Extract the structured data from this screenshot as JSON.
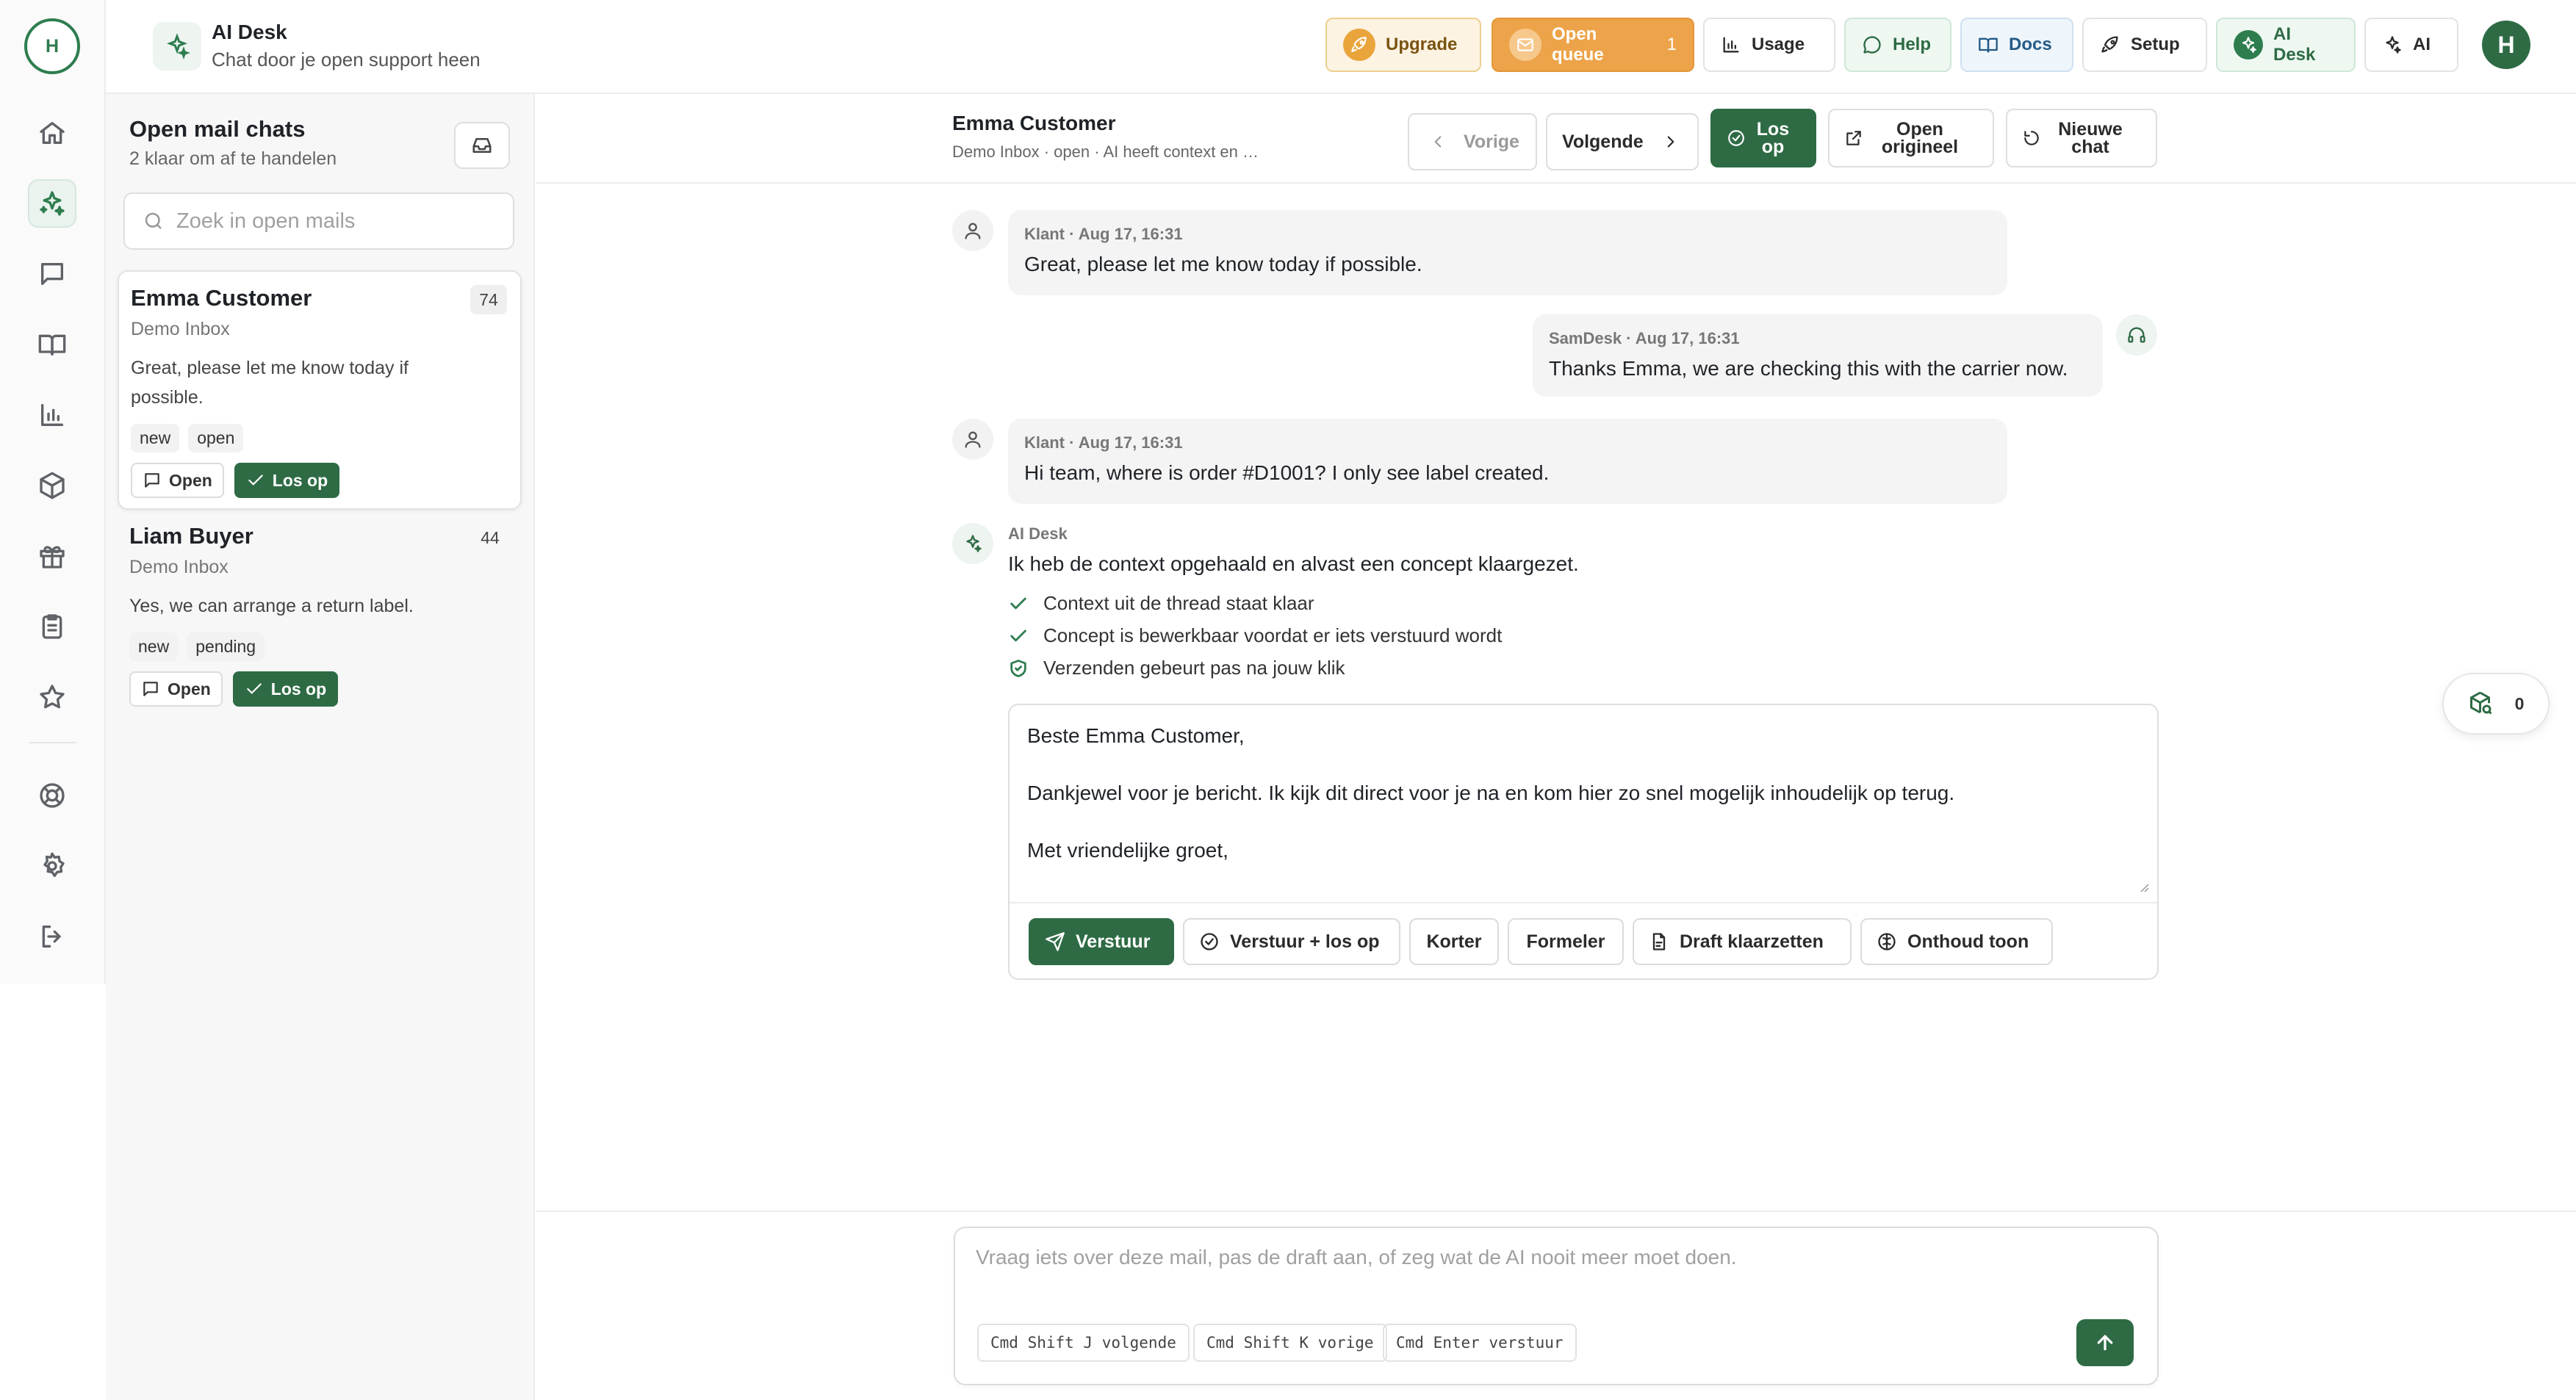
{
  "rail": {
    "avatar_initial": "H",
    "items": [
      {
        "name": "home-icon"
      },
      {
        "name": "sparkles-icon",
        "active": true
      },
      {
        "name": "chat-icon"
      },
      {
        "name": "book-icon"
      },
      {
        "name": "chart-icon"
      },
      {
        "name": "box-icon"
      },
      {
        "name": "gift-icon"
      },
      {
        "name": "clipboard-icon"
      },
      {
        "name": "star-icon"
      },
      {
        "name": "lifebuoy-icon"
      },
      {
        "name": "gear-icon"
      },
      {
        "name": "logout-icon"
      }
    ]
  },
  "header": {
    "title": "AI Desk",
    "subtitle": "Chat door je open support heen",
    "buttons": {
      "upgrade": "Upgrade",
      "open_queue": "Open queue",
      "open_queue_count": "1",
      "usage": "Usage",
      "help": "Help",
      "docs": "Docs",
      "setup": "Setup",
      "ai_desk": "AI Desk",
      "ai": "AI"
    },
    "user_initial": "H"
  },
  "mail_list": {
    "title": "Open mail chats",
    "subtitle": "2 klaar om af te handelen",
    "search_placeholder": "Zoek in open mails",
    "items": [
      {
        "name": "Emma Customer",
        "count": "74",
        "inbox": "Demo Inbox",
        "preview": "Great, please let me know today if possible.",
        "tags": [
          "new",
          "open"
        ],
        "open_label": "Open",
        "resolve_label": "Los op",
        "selected": true
      },
      {
        "name": "Liam Buyer",
        "count": "44",
        "inbox": "Demo Inbox",
        "preview": "Yes, we can arrange a return label.",
        "tags": [
          "new",
          "pending"
        ],
        "open_label": "Open",
        "resolve_label": "Los op",
        "selected": false
      }
    ]
  },
  "conversation": {
    "name": "Emma Customer",
    "meta": "Demo Inbox · open · AI heeft context en concept voo...",
    "buttons": {
      "prev": "Vorige",
      "next": "Volgende",
      "resolve": "Los op",
      "open_original": "Open origineel",
      "new_chat": "Nieuwe chat"
    },
    "messages": [
      {
        "author": "Klant · Aug 17, 16:31",
        "text": "Great, please let me know today if possible.",
        "side": "left"
      },
      {
        "author": "SamDesk · Aug 17, 16:31",
        "text": "Thanks Emma, we are checking this with the carrier now.",
        "side": "right"
      },
      {
        "author": "Klant · Aug 17, 16:31",
        "text": "Hi team, where is order #D1001? I only see label created.",
        "side": "left"
      }
    ],
    "ai": {
      "label": "AI Desk",
      "intro": "Ik heb de context opgehaald en alvast een concept klaargezet.",
      "checks": [
        "Context uit de thread staat klaar",
        "Concept is bewerkbaar voordat er iets verstuurd wordt",
        "Verzenden gebeurt pas na jouw klik"
      ]
    },
    "draft": {
      "text": "Beste Emma Customer,\n\nDankjewel voor je bericht. Ik kijk dit direct voor je na en kom hier zo snel mogelijk inhoudelijk op terug.\n\nMet vriendelijke groet,",
      "buttons": {
        "send": "Verstuur",
        "send_resolve": "Verstuur + los op",
        "shorter": "Korter",
        "formal": "Formeler",
        "draft": "Draft klaarzetten",
        "tone": "Onthoud toon"
      }
    }
  },
  "floating_badge": {
    "count": "0",
    "icon": "package-search-icon"
  },
  "composer": {
    "placeholder": "Vraag iets over deze mail, pas de draft aan, of zeg wat de AI nooit meer moet doen.",
    "hints": [
      "Cmd Shift J volgende",
      "Cmd Shift K vorige",
      "Cmd Enter verstuur"
    ]
  },
  "colors": {
    "accent_green": "#2e6b45",
    "queue_orange": "#eda349",
    "upgrade_bg": "#fcf3e2"
  }
}
